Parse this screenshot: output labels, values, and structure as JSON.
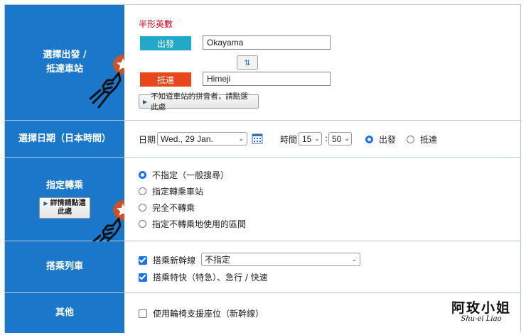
{
  "row1": {
    "label_line1": "選擇出發 /",
    "label_line2": "抵達車站",
    "hint": "半形英數",
    "departure_tag": "出發",
    "departure_value": "Okayama",
    "arrival_tag": "抵達",
    "arrival_value": "Himeji",
    "swap_glyph": "⇅",
    "romaji_help_button": "不知道車站的拼音者，請點選此處"
  },
  "row2": {
    "label": "選擇日期（日本時間）",
    "date_label": "日期",
    "date_value": "Wed., 29 Jan.",
    "time_label": "時間",
    "hour_value": "15",
    "colon": ":",
    "minute_value": "50",
    "departure_option": "出發",
    "arrival_option": "抵達"
  },
  "row3": {
    "label": "指定轉乘",
    "details_button_line1": "詳情請點選",
    "details_button_line2": "此處",
    "options": [
      "不指定（一般搜尋）",
      "指定轉乘車站",
      "完全不轉乘",
      "指定不轉乘地使用的區間"
    ],
    "selected_index": 0
  },
  "row4": {
    "label": "搭乘列車",
    "shinkansen_label": "搭乘新幹線",
    "shinkansen_select": "不指定",
    "express_label": "搭乘特快（特急）、急行 / 快速"
  },
  "row5": {
    "label": "其他",
    "wheelchair_label": "使用輪椅支援座位（新幹線）"
  },
  "watermark": {
    "title": "阿玫小姐",
    "subtitle": "Shu-ei Liao"
  },
  "colors": {
    "label_bg": "#1a77c9",
    "departure_tag": "#22a9c9",
    "arrival_tag": "#e8471b",
    "accent": "#1a73e8"
  }
}
